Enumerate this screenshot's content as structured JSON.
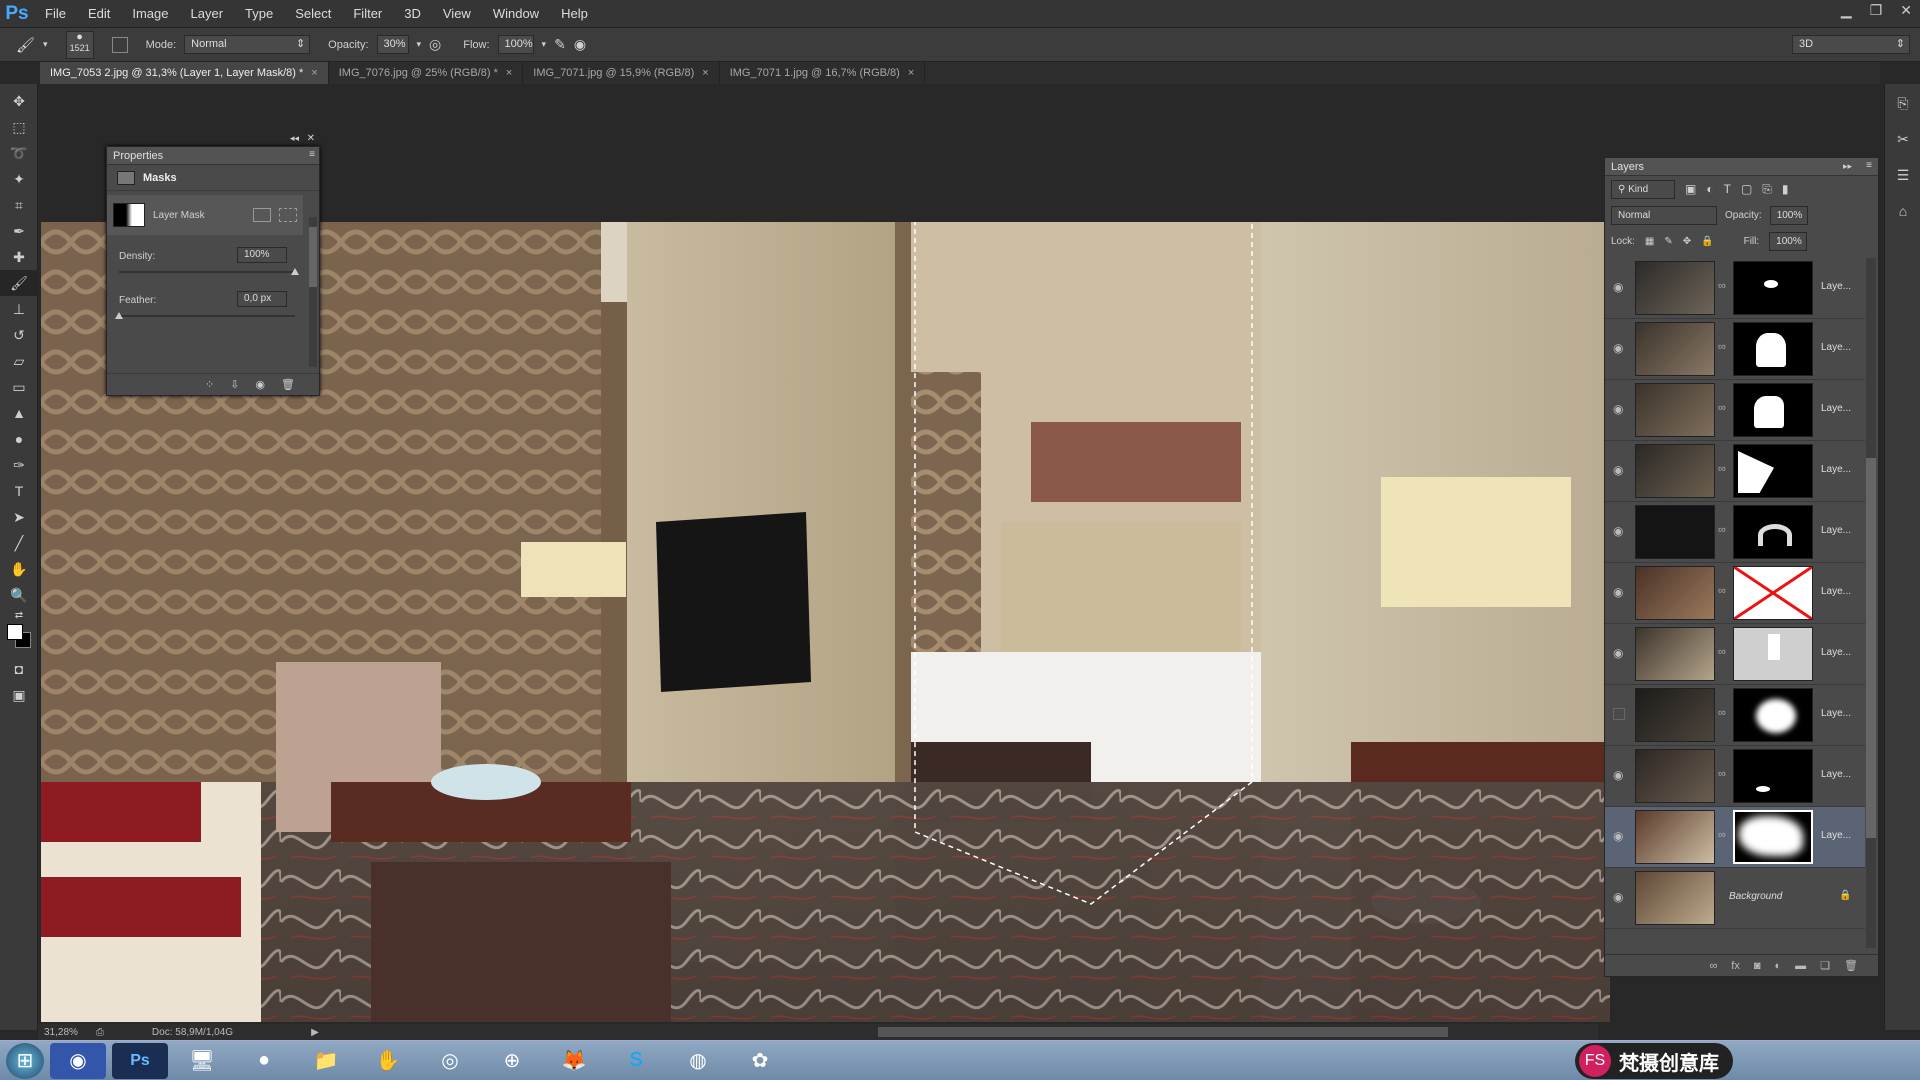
{
  "app": {
    "logo": "Ps"
  },
  "menu": [
    "File",
    "Edit",
    "Image",
    "Layer",
    "Type",
    "Select",
    "Filter",
    "3D",
    "View",
    "Window",
    "Help"
  ],
  "options": {
    "brush_size": "1521",
    "mode_label": "Mode:",
    "mode_value": "Normal",
    "opacity_label": "Opacity:",
    "opacity_value": "30%",
    "flow_label": "Flow:",
    "flow_value": "100%",
    "workspace": "3D"
  },
  "tabs": [
    {
      "label": "IMG_7053 2.jpg @ 31,3% (Layer 1, Layer Mask/8) *"
    },
    {
      "label": "IMG_7076.jpg @ 25% (RGB/8) *"
    },
    {
      "label": "IMG_7071.jpg @ 15,9% (RGB/8)"
    },
    {
      "label": "IMG_7071 1.jpg @ 16,7% (RGB/8)"
    }
  ],
  "properties": {
    "title": "Properties",
    "section": "Masks",
    "mask_name": "Layer Mask",
    "density_label": "Density:",
    "density_value": "100%",
    "density_level": 1.0,
    "feather_label": "Feather:",
    "feather_value": "0,0 px",
    "feather_level": 0.0
  },
  "layers": {
    "title": "Layers",
    "kind_label": "Kind",
    "blend_mode": "Normal",
    "opacity_label": "Opacity:",
    "opacity_value": "100%",
    "lock_label": "Lock:",
    "fill_label": "Fill:",
    "fill_value": "100%",
    "rows": [
      {
        "name": "Laye...",
        "visible": true
      },
      {
        "name": "Laye...",
        "visible": true
      },
      {
        "name": "Laye...",
        "visible": true
      },
      {
        "name": "Laye...",
        "visible": true
      },
      {
        "name": "Laye...",
        "visible": true
      },
      {
        "name": "Laye...",
        "visible": true
      },
      {
        "name": "Laye...",
        "visible": true
      },
      {
        "name": "Laye...",
        "visible": false
      },
      {
        "name": "Laye...",
        "visible": true
      },
      {
        "name": "Laye...",
        "visible": true,
        "selected": true
      },
      {
        "name": "Background",
        "visible": true
      }
    ]
  },
  "status": {
    "zoom": "31,28%",
    "doc": "Doc: 58,9M/1,04G"
  },
  "watermark": "梵摄创意库"
}
